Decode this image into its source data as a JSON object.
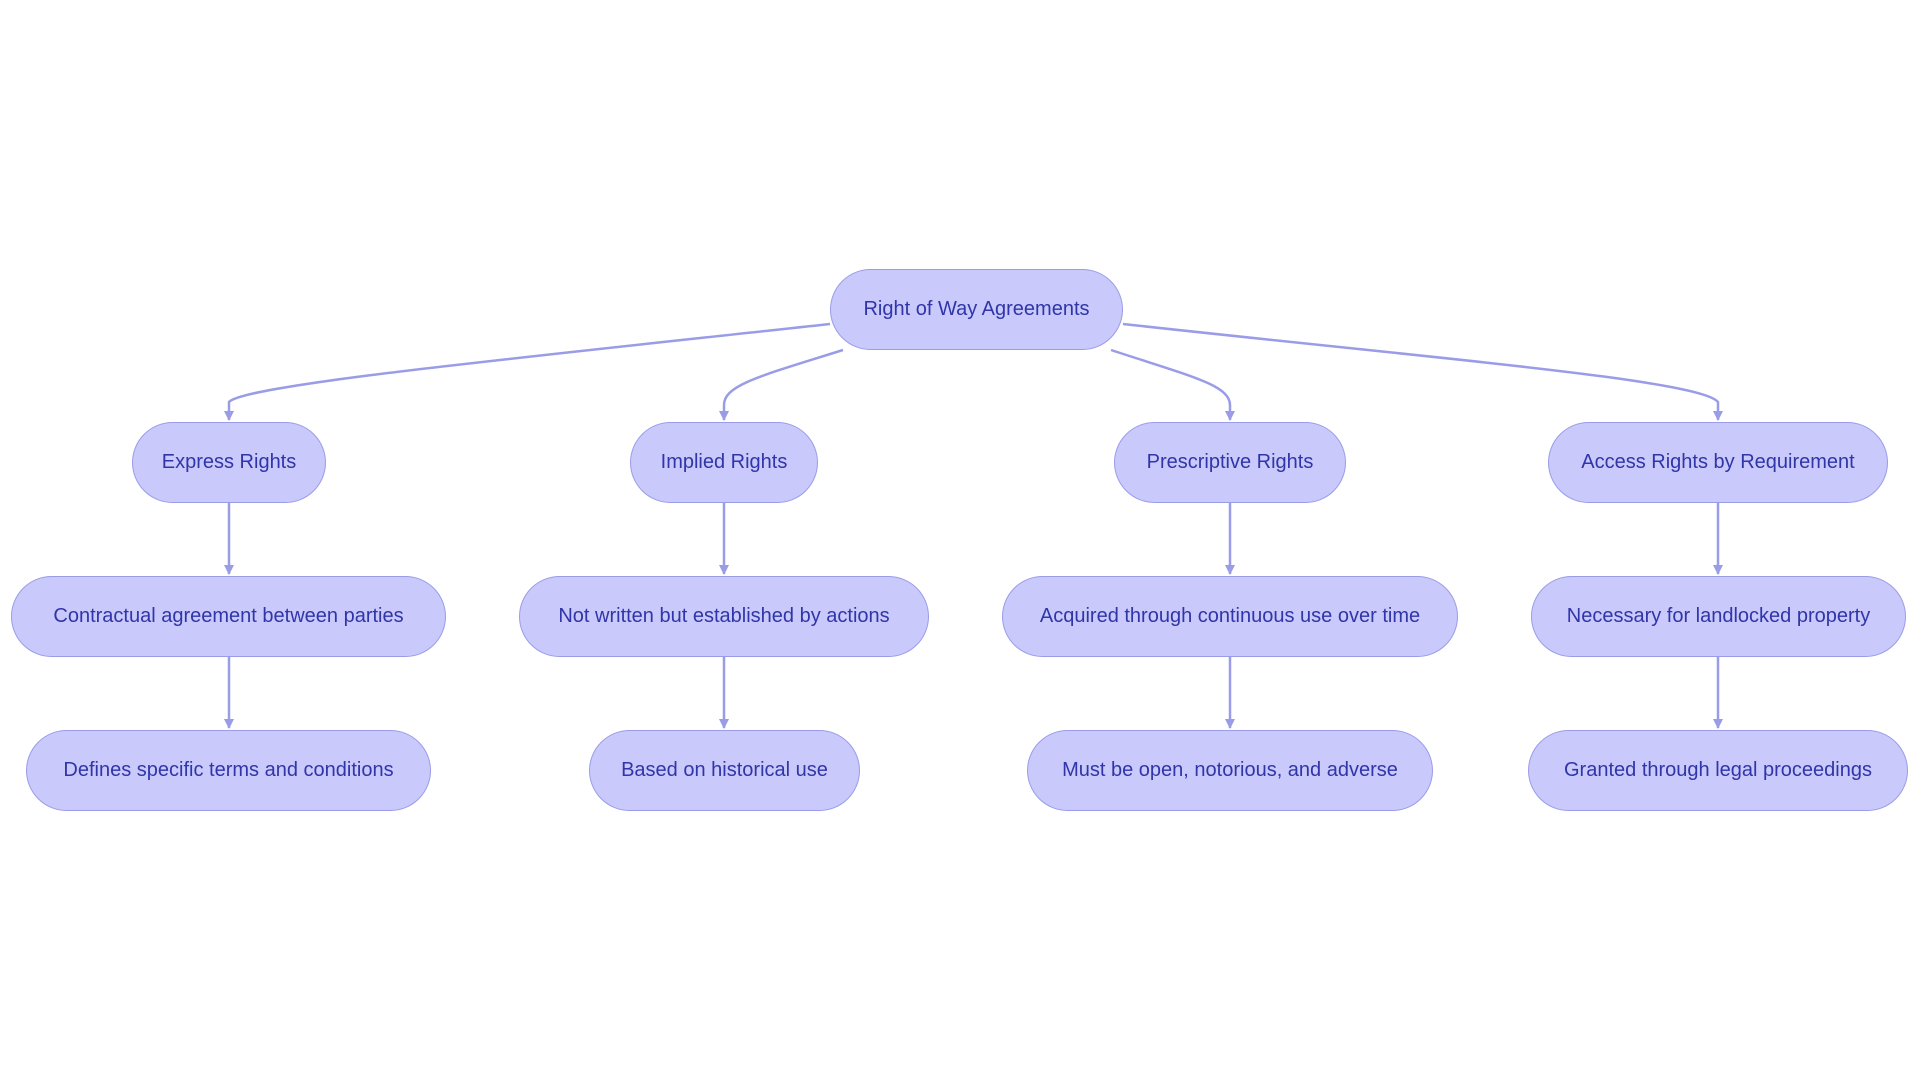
{
  "diagram": {
    "colors": {
      "node_fill": "#c9c9fc",
      "node_border": "#9a9ce8",
      "edge": "#9a9ce8",
      "text": "#3035a8"
    },
    "root": {
      "id": "root",
      "label": "Right of Way Agreements"
    },
    "branches": [
      {
        "id": "express",
        "label": "Express Rights",
        "children": [
          "Contractual agreement between parties",
          "Defines specific terms and conditions"
        ]
      },
      {
        "id": "implied",
        "label": "Implied Rights",
        "children": [
          "Not written but established by actions",
          "Based on historical use"
        ]
      },
      {
        "id": "prescriptive",
        "label": "Prescriptive Rights",
        "children": [
          "Acquired through continuous use over time",
          "Must be open, notorious, and adverse"
        ]
      },
      {
        "id": "access",
        "label": "Access Rights by Requirement",
        "children": [
          "Necessary for landlocked property",
          "Granted through legal proceedings"
        ]
      }
    ],
    "edges": [
      [
        "root",
        "express"
      ],
      [
        "root",
        "implied"
      ],
      [
        "root",
        "prescriptive"
      ],
      [
        "root",
        "access"
      ],
      [
        "express",
        "express-1"
      ],
      [
        "express-1",
        "express-2"
      ],
      [
        "implied",
        "implied-1"
      ],
      [
        "implied-1",
        "implied-2"
      ],
      [
        "prescriptive",
        "prescriptive-1"
      ],
      [
        "prescriptive-1",
        "prescriptive-2"
      ],
      [
        "access",
        "access-1"
      ],
      [
        "access-1",
        "access-2"
      ]
    ]
  }
}
